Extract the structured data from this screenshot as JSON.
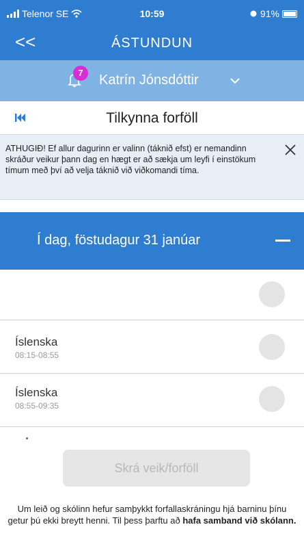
{
  "status_bar": {
    "carrier": "Telenor SE",
    "time": "10:59",
    "battery": "91%"
  },
  "header": {
    "back_glyph": "<<",
    "title": "ÁSTUNDUN"
  },
  "user": {
    "notification_count": "7",
    "name": "Katrín Jónsdóttir"
  },
  "page": {
    "title": "Tilkynna forföll"
  },
  "notice": {
    "text": "ATHUGIÐ! Ef allur dagurinn er valinn (táknið efst) er nemandinn skráður veikur þann dag en hægt er að sækja um leyfi í einstökum tímum með því að velja táknið við viðkomandi tíma."
  },
  "day": {
    "label": "Í dag, föstudagur 31 janúar"
  },
  "lessons": [
    {
      "subject": "Íslenska",
      "time": "08:15-08:55"
    },
    {
      "subject": "Íslenska",
      "time": "08:55-09:35"
    }
  ],
  "submit": {
    "label": "Skrá veik/forföll"
  },
  "footer": {
    "text_plain": "Um leið og skólinn hefur samþykkt forfallaskráningu hjá barninu þínu getur þú ekki breytt henni. Til þess þarftu að ",
    "text_bold": "hafa samband við skólann."
  },
  "colors": {
    "primary": "#2e7dd1",
    "user_bar": "#7fb3e4",
    "badge": "#d92cd2",
    "notice_bg": "#e8eef5"
  }
}
